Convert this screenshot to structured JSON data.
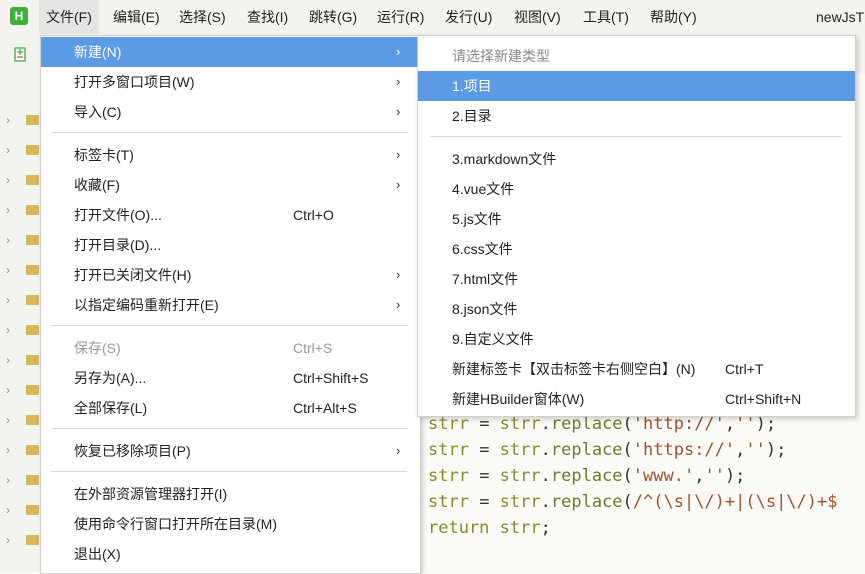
{
  "menubar": {
    "logo": "H",
    "items": [
      "文件(F)",
      "编辑(E)",
      "选择(S)",
      "查找(I)",
      "跳转(G)",
      "运行(R)",
      "发行(U)",
      "视图(V)",
      "工具(T)",
      "帮助(Y)"
    ],
    "window_title": "newJsT"
  },
  "file_menu": {
    "items": [
      {
        "label": "新建(N)",
        "shortcut": "",
        "arrow": "›"
      },
      {
        "label": "打开多窗口项目(W)",
        "shortcut": "",
        "arrow": "›"
      },
      {
        "label": "导入(C)",
        "shortcut": "",
        "arrow": "›"
      },
      {
        "label": "标签卡(T)",
        "shortcut": "",
        "arrow": "›"
      },
      {
        "label": "收藏(F)",
        "shortcut": "",
        "arrow": "›"
      },
      {
        "label": "打开文件(O)...",
        "shortcut": "Ctrl+O",
        "arrow": ""
      },
      {
        "label": "打开目录(D)...",
        "shortcut": "",
        "arrow": ""
      },
      {
        "label": "打开已关闭文件(H)",
        "shortcut": "",
        "arrow": "›"
      },
      {
        "label": "以指定编码重新打开(E)",
        "shortcut": "",
        "arrow": "›"
      },
      {
        "label": "保存(S)",
        "shortcut": "Ctrl+S",
        "arrow": ""
      },
      {
        "label": "另存为(A)...",
        "shortcut": "Ctrl+Shift+S",
        "arrow": ""
      },
      {
        "label": "全部保存(L)",
        "shortcut": "Ctrl+Alt+S",
        "arrow": ""
      },
      {
        "label": "恢复已移除项目(P)",
        "shortcut": "",
        "arrow": "›"
      },
      {
        "label": "在外部资源管理器打开(I)",
        "shortcut": "",
        "arrow": ""
      },
      {
        "label": "使用命令行窗口打开所在目录(M)",
        "shortcut": "",
        "arrow": ""
      },
      {
        "label": "退出(X)",
        "shortcut": "",
        "arrow": ""
      }
    ]
  },
  "new_submenu": {
    "header": "请选择新建类型",
    "items": [
      {
        "label": "1.项目",
        "shortcut": ""
      },
      {
        "label": "2.目录",
        "shortcut": ""
      },
      {
        "label": "3.markdown文件",
        "shortcut": ""
      },
      {
        "label": "4.vue文件",
        "shortcut": ""
      },
      {
        "label": "5.js文件",
        "shortcut": ""
      },
      {
        "label": "6.css文件",
        "shortcut": ""
      },
      {
        "label": "7.html文件",
        "shortcut": ""
      },
      {
        "label": "8.json文件",
        "shortcut": ""
      },
      {
        "label": "9.自定义文件",
        "shortcut": ""
      },
      {
        "label": "新建标签卡【双击标签卡右侧空白】(N)",
        "shortcut": "Ctrl+T"
      },
      {
        "label": "新建HBuilder窗体(W)",
        "shortcut": "Ctrl+Shift+N"
      }
    ]
  },
  "editor": {
    "lines": [
      {
        "v": "strr",
        "eq": " = ",
        "obj": "strr",
        "dot": ".",
        "fn": "replace",
        "open": "(",
        "arg1": "'http://'",
        "comma": ",",
        "arg2": "''",
        "close": ");"
      },
      {
        "v": "strr",
        "eq": " = ",
        "obj": "strr",
        "dot": ".",
        "fn": "replace",
        "open": "(",
        "arg1": "'https://'",
        "comma": ",",
        "arg2": "''",
        "close": ");"
      },
      {
        "v": "strr",
        "eq": " = ",
        "obj": "strr",
        "dot": ".",
        "fn": "replace",
        "open": "(",
        "arg1": "'www.'",
        "comma": ",",
        "arg2": "''",
        "close": ");"
      },
      {
        "v": "strr",
        "eq": " = ",
        "obj": "strr",
        "dot": ".",
        "fn": "replace",
        "open": "(",
        "arg1": "/^(\\s|\\/)+|(\\s|\\/)+$",
        "comma": "",
        "arg2": "",
        "close": ""
      },
      {
        "v": "return",
        "eq": " ",
        "obj": "strr",
        "dot": "",
        "fn": "",
        "open": "",
        "arg1": "",
        "comma": "",
        "arg2": "",
        "close": ";"
      }
    ]
  },
  "colors": {
    "accent": "#5b9be6",
    "menu_bg": "#ffffff",
    "editor_bg": "#fafaf6"
  }
}
